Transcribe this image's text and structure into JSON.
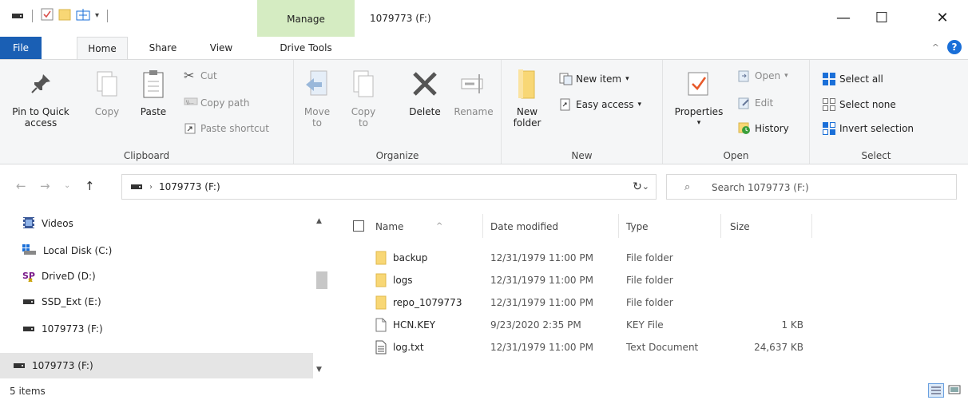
{
  "window": {
    "title": "1079773 (F:)",
    "context_tab": "Manage",
    "controls": {
      "minimize": "—",
      "maximize": "☐",
      "close": "✕"
    }
  },
  "tabs": {
    "file": "File",
    "home": "Home",
    "share": "Share",
    "view": "View",
    "drive_tools": "Drive Tools"
  },
  "ribbon": {
    "clipboard": {
      "label": "Clipboard",
      "pin": "Pin to Quick access",
      "copy": "Copy",
      "paste": "Paste",
      "cut": "Cut",
      "copy_path": "Copy path",
      "paste_shortcut": "Paste shortcut"
    },
    "organize": {
      "label": "Organize",
      "move_to": "Move to",
      "copy_to": "Copy to",
      "delete": "Delete",
      "rename": "Rename"
    },
    "new": {
      "label": "New",
      "new_folder": "New folder",
      "new_item": "New item",
      "easy_access": "Easy access"
    },
    "open": {
      "label": "Open",
      "properties": "Properties",
      "open": "Open",
      "edit": "Edit",
      "history": "History"
    },
    "select": {
      "label": "Select",
      "select_all": "Select all",
      "select_none": "Select none",
      "invert_selection": "Invert selection"
    }
  },
  "address": {
    "path": "1079773 (F:)",
    "search_placeholder": "Search 1079773 (F:)"
  },
  "nav_pane": {
    "items": [
      {
        "label": "Videos",
        "icon": "video-icon"
      },
      {
        "label": "Local Disk (C:)",
        "icon": "windows-drive-icon"
      },
      {
        "label": "DriveD (D:)",
        "icon": "sd-drive-icon"
      },
      {
        "label": "SSD_Ext (E:)",
        "icon": "drive-icon"
      },
      {
        "label": "1079773 (F:)",
        "icon": "drive-icon"
      },
      {
        "label": "1079773 (F:)",
        "icon": "drive-icon"
      }
    ]
  },
  "file_list": {
    "columns": {
      "name": "Name",
      "date": "Date modified",
      "type": "Type",
      "size": "Size"
    },
    "rows": [
      {
        "name": "backup",
        "date": "12/31/1979 11:00 PM",
        "type": "File folder",
        "size": "",
        "icon": "folder-icon"
      },
      {
        "name": "logs",
        "date": "12/31/1979 11:00 PM",
        "type": "File folder",
        "size": "",
        "icon": "folder-icon"
      },
      {
        "name": "repo_1079773",
        "date": "12/31/1979 11:00 PM",
        "type": "File folder",
        "size": "",
        "icon": "folder-icon"
      },
      {
        "name": "HCN.KEY",
        "date": "9/23/2020 2:35 PM",
        "type": "KEY File",
        "size": "1 KB",
        "icon": "blank-file-icon"
      },
      {
        "name": "log.txt",
        "date": "12/31/1979 11:00 PM",
        "type": "Text Document",
        "size": "24,637 KB",
        "icon": "text-file-icon"
      }
    ]
  },
  "status": {
    "items": "5 items"
  },
  "colors": {
    "file_tab": "#1a5fb4",
    "manage_tab": "#d5ecc2",
    "folder": "#f8d775",
    "select_blue": "#1a6fd8"
  }
}
